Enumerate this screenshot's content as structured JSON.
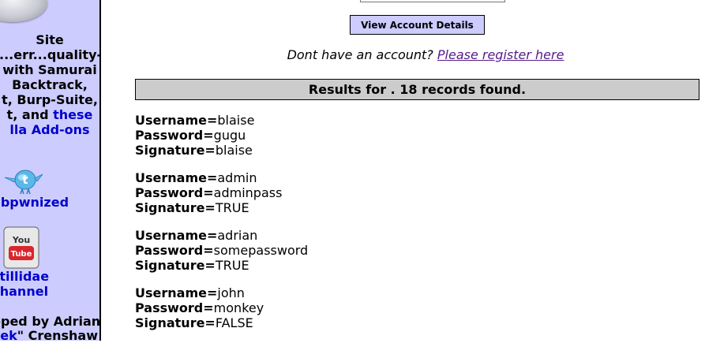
{
  "sidebar": {
    "lines": [
      "Site",
      "...err...quality-",
      "with Samurai",
      "Backtrack,",
      "t, Burp-Suite,"
    ],
    "line5_prefix": "t, and ",
    "line5_link": "these",
    "line6_link": "lla Add-ons",
    "twitter_label": "ebpwnized",
    "youtube_label_1": "utillidae",
    "youtube_label_2": "Channel",
    "dev_line1": "oped by Adrian",
    "dev_link": "ek",
    "dev_line2_suffix": "\" Crenshaw",
    "twitter_icon_text": "t",
    "youtube_icon_text_1": "You",
    "youtube_icon_text_2": "Tube",
    "colors": {
      "background": "#ccccff",
      "link": "#0000cc"
    }
  },
  "form": {
    "view_button_label": "View Account Details",
    "register_prompt": "Dont have an account?",
    "register_link": "Please register here"
  },
  "results": {
    "header": "Results for . 18 records found.",
    "label_username": "Username=",
    "label_password": "Password=",
    "label_signature": "Signature=",
    "records": [
      {
        "username": "blaise",
        "password": "gugu",
        "signature": "blaise"
      },
      {
        "username": "admin",
        "password": "adminpass",
        "signature": "TRUE"
      },
      {
        "username": "adrian",
        "password": "somepassword",
        "signature": "TRUE"
      },
      {
        "username": "john",
        "password": "monkey",
        "signature": "FALSE"
      }
    ]
  }
}
